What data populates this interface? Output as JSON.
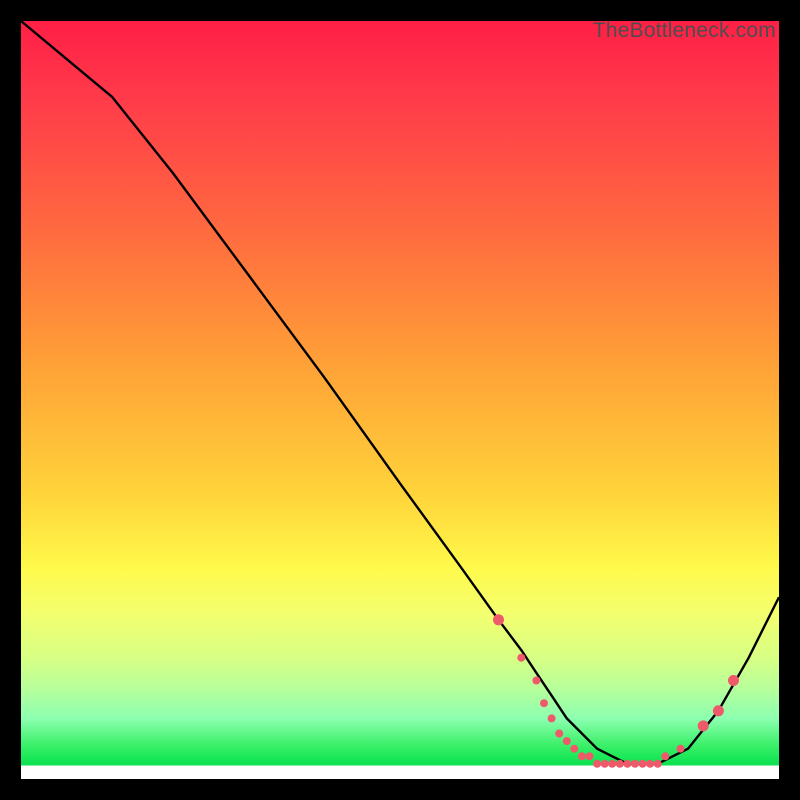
{
  "watermark": "TheBottleneck.com",
  "chart_data": {
    "type": "line",
    "title": "",
    "xlabel": "",
    "ylabel": "",
    "xlim": [
      0,
      100
    ],
    "ylim": [
      0,
      100
    ],
    "series": [
      {
        "name": "curve",
        "x": [
          0,
          6,
          12,
          20,
          30,
          40,
          50,
          58,
          63,
          66,
          68,
          70,
          72,
          74,
          76,
          78,
          80,
          82,
          84,
          88,
          92,
          96,
          100
        ],
        "values": [
          100,
          95,
          90,
          80,
          66.5,
          53,
          39,
          28,
          21,
          17,
          14,
          11,
          8,
          6,
          4,
          3,
          2,
          2,
          2,
          4,
          9,
          16,
          24
        ]
      }
    ],
    "markers": {
      "name": "bottom-dots",
      "color": "#ef5a6a",
      "radius_large": 5.5,
      "radius_small": 4.0,
      "points": [
        {
          "x": 63,
          "y": 21,
          "r": "large"
        },
        {
          "x": 66,
          "y": 16,
          "r": "small"
        },
        {
          "x": 68,
          "y": 13,
          "r": "small"
        },
        {
          "x": 69,
          "y": 10,
          "r": "small"
        },
        {
          "x": 70,
          "y": 8,
          "r": "small"
        },
        {
          "x": 71,
          "y": 6,
          "r": "small"
        },
        {
          "x": 72,
          "y": 5,
          "r": "small"
        },
        {
          "x": 73,
          "y": 4,
          "r": "small"
        },
        {
          "x": 74,
          "y": 3,
          "r": "small"
        },
        {
          "x": 75,
          "y": 3,
          "r": "small"
        },
        {
          "x": 76,
          "y": 2,
          "r": "small"
        },
        {
          "x": 77,
          "y": 2,
          "r": "small"
        },
        {
          "x": 78,
          "y": 2,
          "r": "small"
        },
        {
          "x": 79,
          "y": 2,
          "r": "small"
        },
        {
          "x": 80,
          "y": 2,
          "r": "small"
        },
        {
          "x": 81,
          "y": 2,
          "r": "small"
        },
        {
          "x": 82,
          "y": 2,
          "r": "small"
        },
        {
          "x": 83,
          "y": 2,
          "r": "small"
        },
        {
          "x": 84,
          "y": 2,
          "r": "small"
        },
        {
          "x": 85,
          "y": 3,
          "r": "small"
        },
        {
          "x": 87,
          "y": 4,
          "r": "small"
        },
        {
          "x": 90,
          "y": 7,
          "r": "large"
        },
        {
          "x": 92,
          "y": 9,
          "r": "large"
        },
        {
          "x": 94,
          "y": 13,
          "r": "large"
        }
      ]
    },
    "colors": {
      "line": "#000000",
      "marker": "#ef5a6a",
      "background_top": "#ff1f46",
      "background_bottom": "#19e858"
    }
  }
}
